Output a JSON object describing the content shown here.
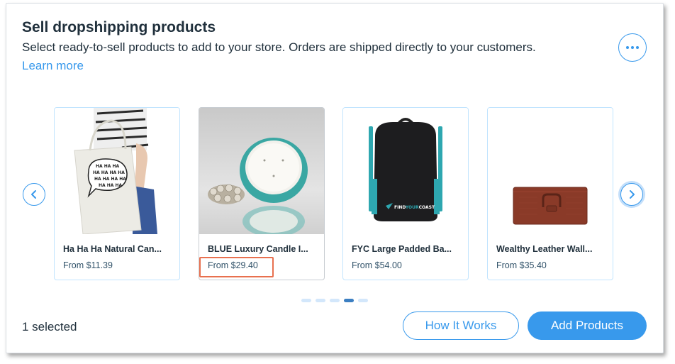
{
  "header": {
    "title": "Sell dropshipping products",
    "subtitle": "Select ready-to-sell products to add to your store. Orders are shipped directly to your customers.",
    "learn_more": "Learn more",
    "more_icon": "ellipsis-icon"
  },
  "carousel": {
    "prev_icon": "chevron-left-icon",
    "next_icon": "chevron-right-icon",
    "products": [
      {
        "name": "Ha Ha Ha Natural Can...",
        "price": "From $11.39",
        "image": "tote-bag",
        "image_text": "HA HA HA HA HA HA HA HA HA HA HA HA HA HA"
      },
      {
        "name": "BLUE Luxury Candle I...",
        "price": "From $29.40",
        "image": "candle"
      },
      {
        "name": "FYC Large Padded Ba...",
        "price": "From $54.00",
        "image": "backpack",
        "image_text": "FINDYOURCOAST"
      },
      {
        "name": "Wealthy Leather Wall...",
        "price": "From $35.40",
        "image": "wallet"
      }
    ],
    "pages": 5,
    "active_page": 4
  },
  "footer": {
    "selected_text": "1 selected",
    "how_it_works": "How It Works",
    "add_products": "Add Products"
  },
  "colors": {
    "accent": "#3899ec",
    "highlight": "#e8704f",
    "text": "#20303c"
  }
}
